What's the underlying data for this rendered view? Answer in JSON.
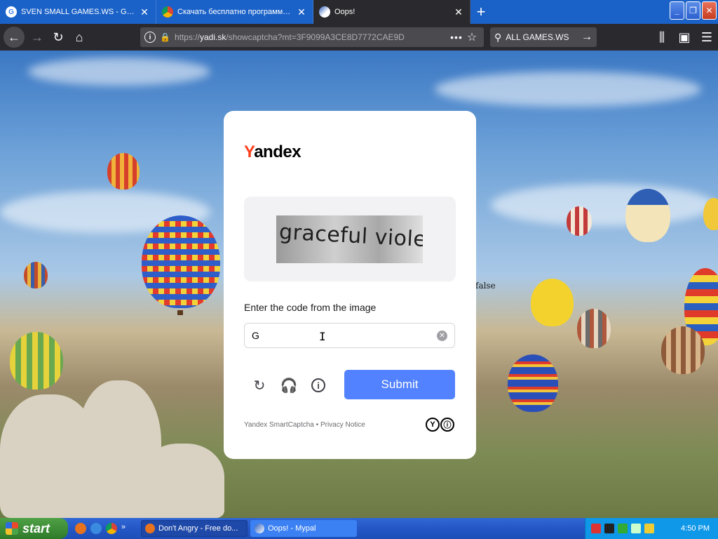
{
  "browser": {
    "tabs": [
      {
        "title": "SVEN SMALL GAMES.WS - Google",
        "favicon": "google-icon"
      },
      {
        "title": "Скачать бесплатно программы л",
        "favicon": "chrome-icon"
      },
      {
        "title": "Oops!",
        "favicon": "oops-icon",
        "active": true
      }
    ],
    "new_tab": "+",
    "url_prefix": "https://",
    "url_host": "yadi.sk",
    "url_path": "/showcaptcha?mt=3F9099A3CE8D7772CAE9D",
    "search_text": "ALL GAMES.WS"
  },
  "captcha": {
    "brand_y": "Y",
    "brand_rest": "andex",
    "image_text": "graceful violet",
    "prompt": "Enter the code from the image",
    "input_value": "G",
    "submit_label": "Submit",
    "footer_product": "Yandex SmartCaptcha",
    "footer_sep": " • ",
    "footer_link": "Privacy Notice",
    "brandmark_1": "Y",
    "brandmark_2": "ⓘ"
  },
  "stray_text": "false",
  "taskbar": {
    "start_label": "start",
    "tasks": [
      {
        "title": "Don't Angry - Free do..."
      },
      {
        "title": "Oops! - Mypal"
      }
    ],
    "help_label": "?",
    "clock": "4:50 PM"
  },
  "colors": {
    "accent": "#5282ff",
    "yandex_red": "#fc3f1d",
    "tabstrip": "#1b62c8",
    "toolbar": "#2a2a2e"
  }
}
